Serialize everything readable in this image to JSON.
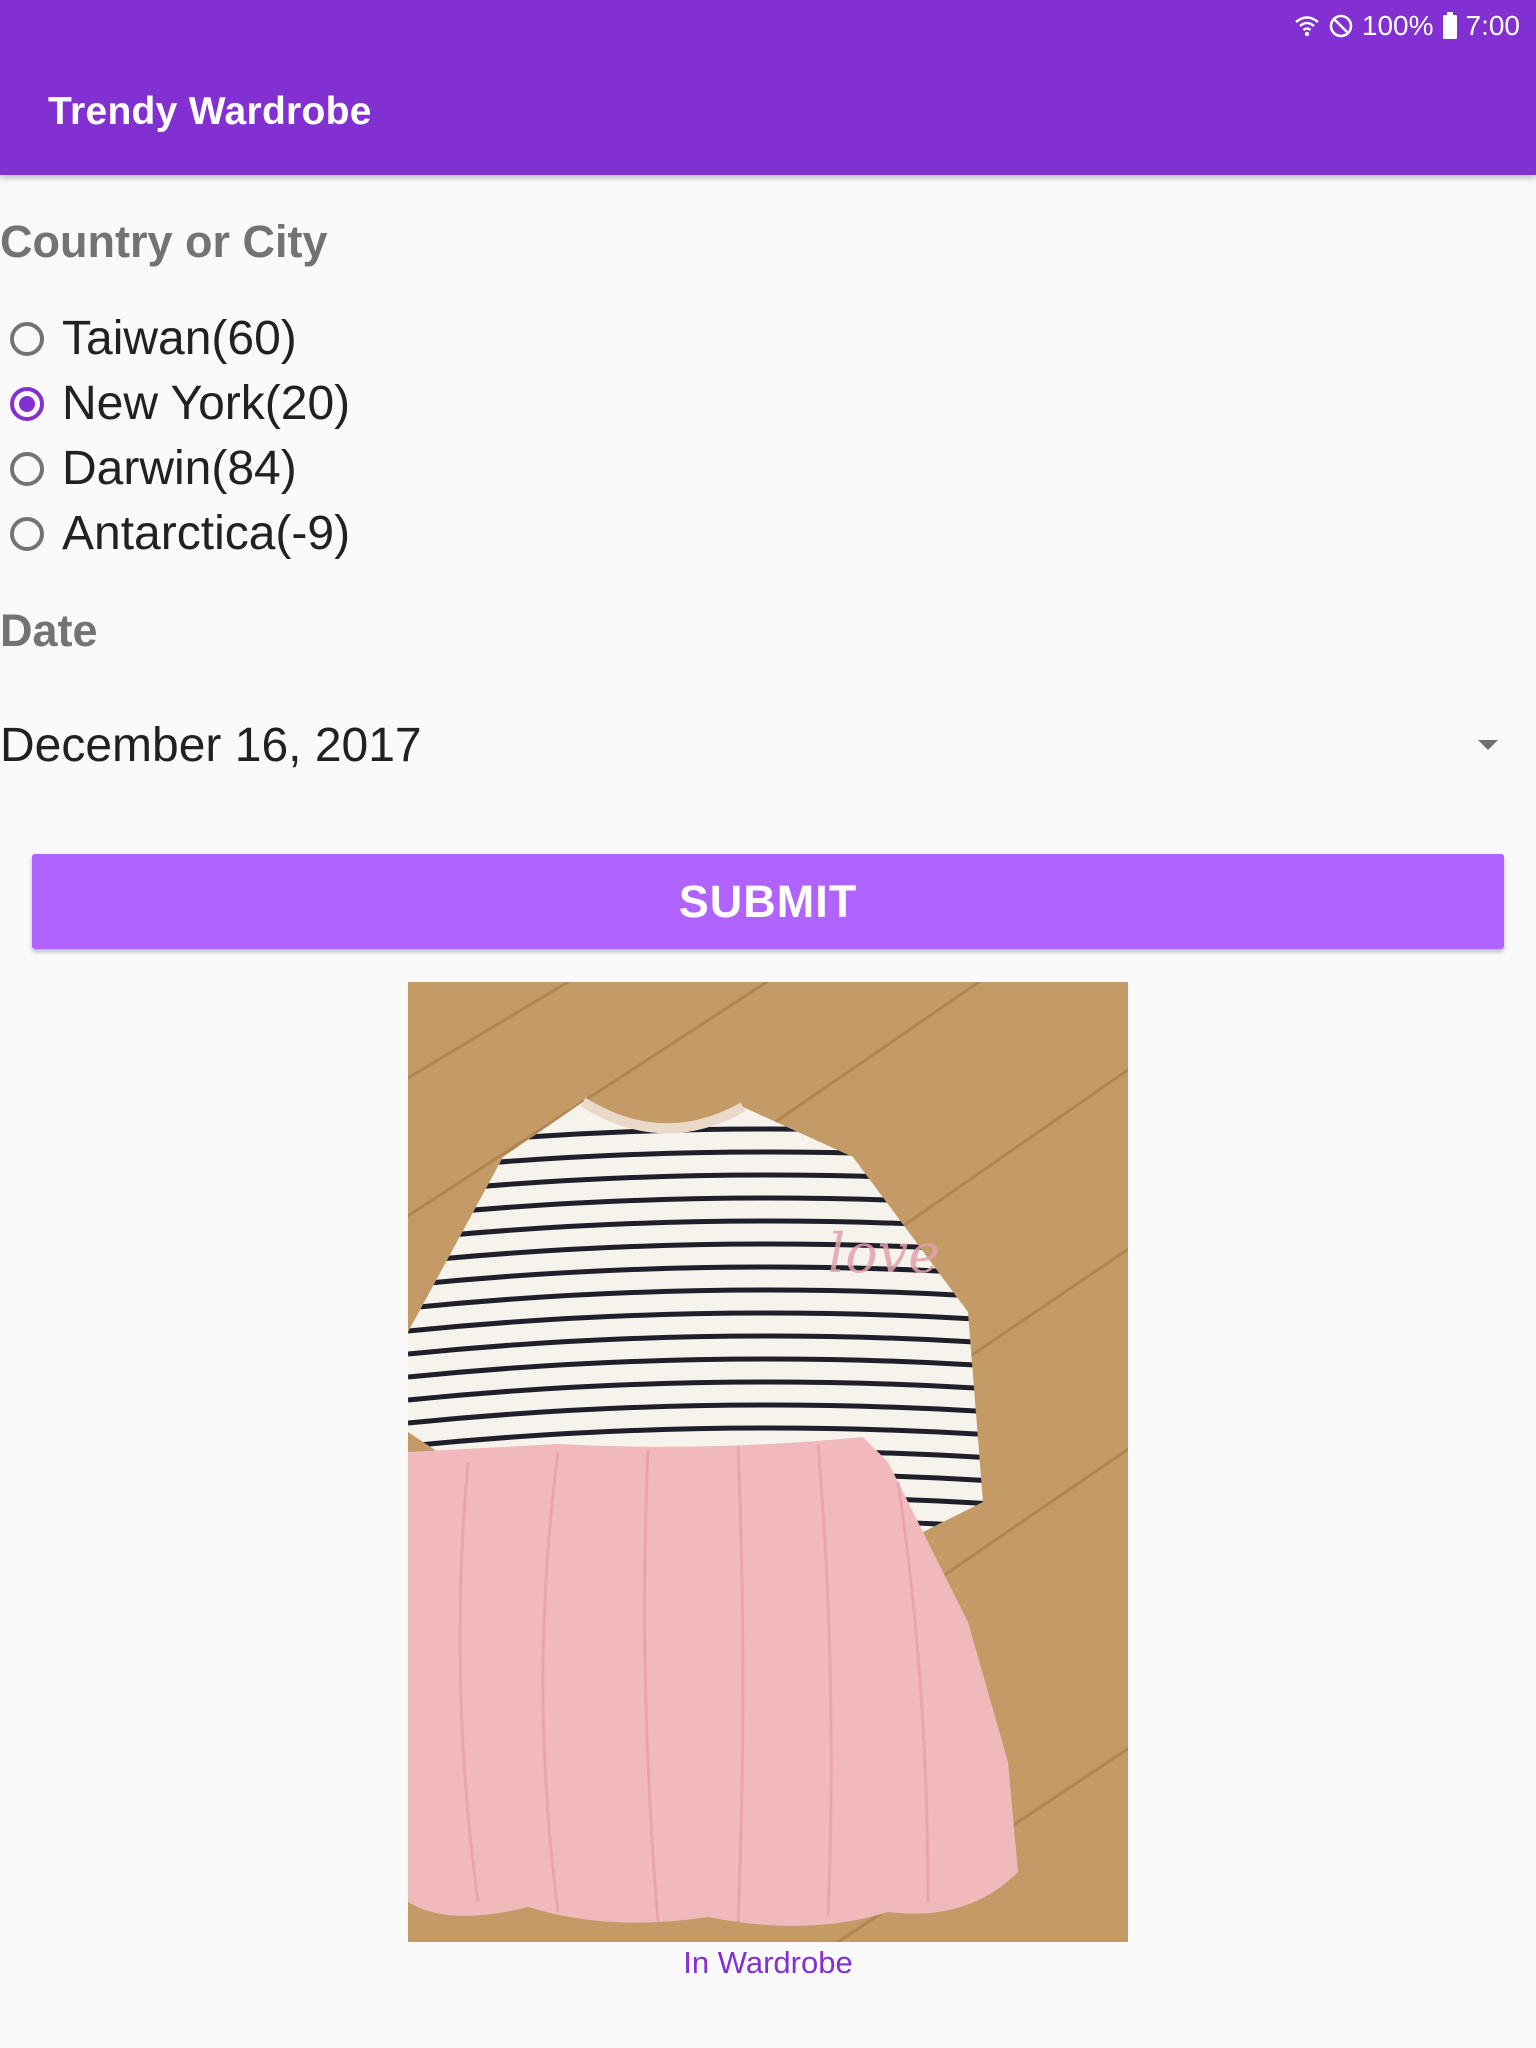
{
  "status_bar": {
    "battery": "100%",
    "time": "7:00"
  },
  "app": {
    "title": "Trendy Wardrobe",
    "primary_color": "#8230d1",
    "accent_color": "#b063ff"
  },
  "form": {
    "location_label": "Country or City",
    "locations": [
      {
        "label": "Taiwan(60)",
        "checked": false
      },
      {
        "label": "New York(20)",
        "checked": true
      },
      {
        "label": "Darwin(84)",
        "checked": false
      },
      {
        "label": "Antarctica(-9)",
        "checked": false
      }
    ],
    "date_label": "Date",
    "date_value": "December 16, 2017",
    "submit_label": "SUBMIT"
  },
  "result": {
    "caption": "In Wardrobe"
  }
}
